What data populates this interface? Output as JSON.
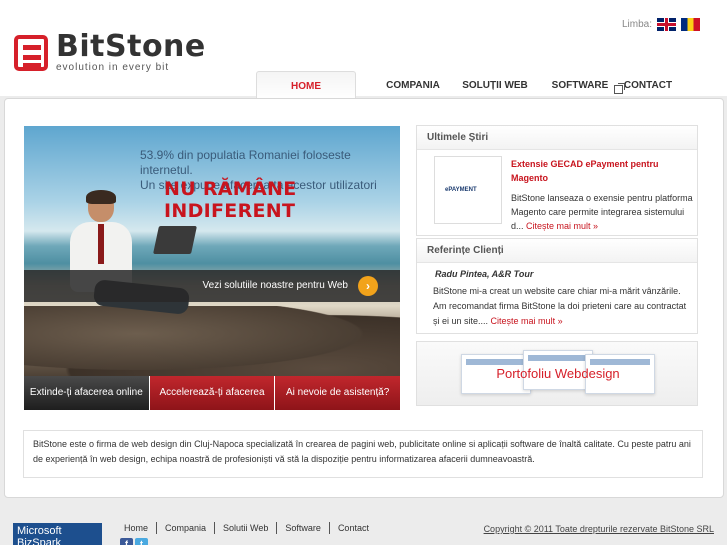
{
  "header": {
    "lang_label": "Limba:",
    "languages": [
      "en-flag-icon",
      "ro-flag-icon"
    ],
    "logo_name": "BitStone",
    "logo_tagline": "evolution in every bit"
  },
  "nav": {
    "items": [
      {
        "label": "HOME",
        "active": true
      },
      {
        "label": "COMPANIA"
      },
      {
        "label": "SOLUȚII WEB"
      },
      {
        "label": "SOFTWARE"
      },
      {
        "label": "CONTACT"
      }
    ]
  },
  "banner": {
    "text_line1": "53.9% din populatia Romaniei foloseste internetul.",
    "text_line2": "Un site expune afacerea ta acestor utilizatori",
    "headline": "NU RĂMÂNE INDIFERENT",
    "cta": "Vezi solutiile noastre pentru Web",
    "cta_icon": "chevron-right-icon"
  },
  "tabs": [
    "Extinde-ți afacerea online",
    "Accelerează-ți afacerea",
    "Ai nevoie de asistență?"
  ],
  "news": {
    "title": "Ultimele Știri",
    "thumb_text": "ePAYMENT",
    "headline": "Extensie GECAD ePayment pentru Magento",
    "body": "BitStone lanseaza o exensie pentru platforma Magento care permite integrarea sistemului d...",
    "more": "Citește mai mult »"
  },
  "references": {
    "title": "Referințe Clienți",
    "name": "Radu Pintea, A&R Tour",
    "body": "BitStone mi-a creat un website care chiar mi-a mărit vânzările. Am recomandat firma BitStone la doi prieteni care au contractat și ei un site....",
    "more": "Citește mai mult »"
  },
  "portfolio": {
    "label": "Portofoliu Webdesign"
  },
  "about": "BitStone este o firma de web design din Cluj-Napoca specializată în crearea de pagini web, publicitate online si aplicații software de înaltă calitate. Cu peste patru ani de experiență în web design, echipa noastră de profesioniști vă stă la dispoziție pentru informatizarea afacerii dumneavoastră.",
  "footer": {
    "partner": "Microsoft BizSpark",
    "links": [
      "Home",
      "Compania",
      "Solutii Web",
      "Software",
      "Contact"
    ],
    "social": [
      "f",
      "t"
    ],
    "copyright": "Copyright © 2011 Toate drepturile rezervate BitStone SRL"
  }
}
